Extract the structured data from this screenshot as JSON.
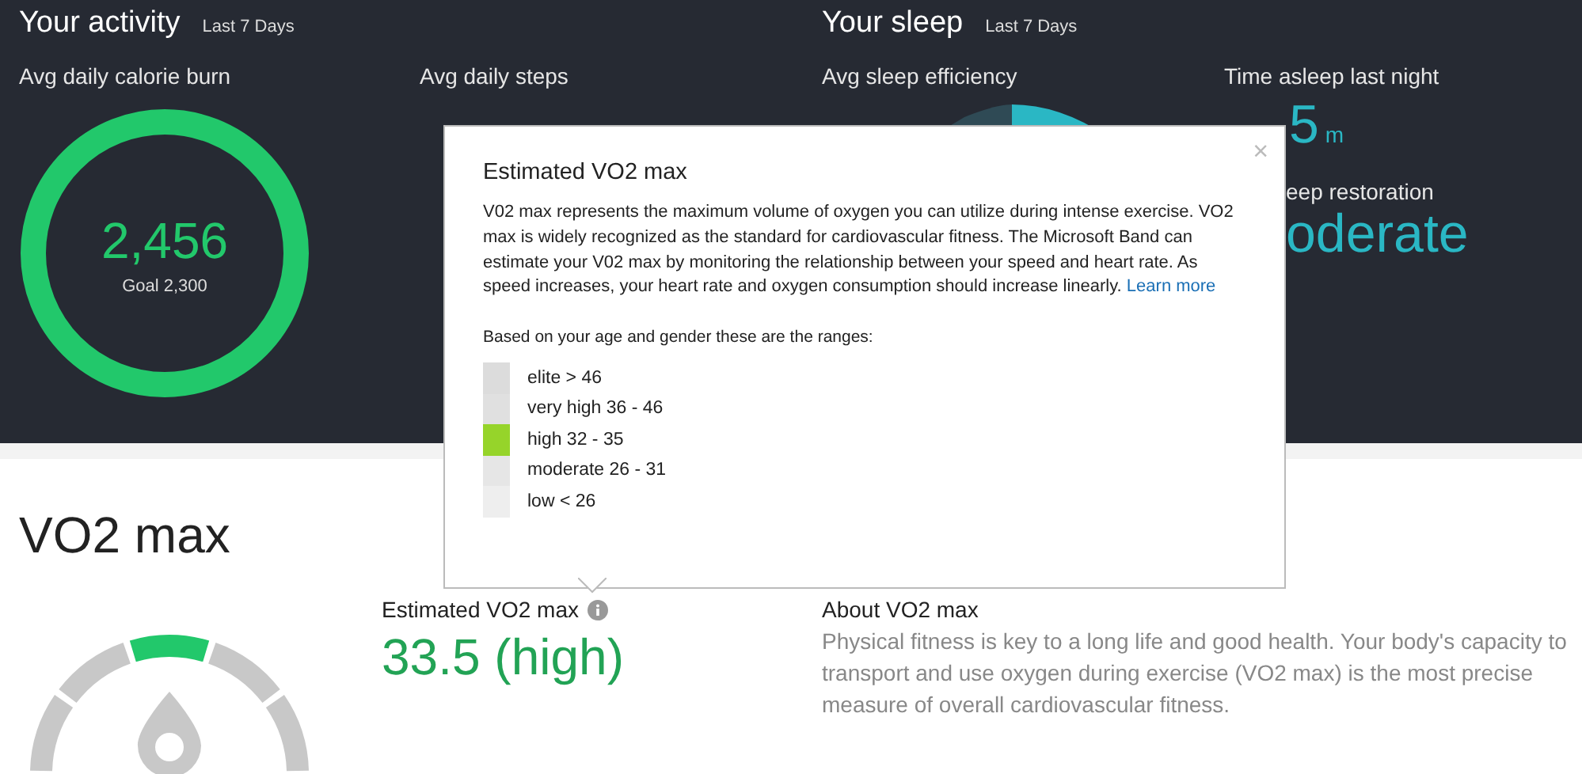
{
  "activity": {
    "title": "Your activity",
    "period": "Last 7 Days",
    "calorie": {
      "label": "Avg daily calorie burn",
      "value": "2,456",
      "goal": "Goal 2,300"
    },
    "steps": {
      "label": "Avg daily steps"
    }
  },
  "sleep": {
    "title": "Your sleep",
    "period": "Last 7 Days",
    "efficiency": {
      "label": "Avg sleep efficiency"
    },
    "time_asleep": {
      "label": "Time asleep last night",
      "minutes": "5",
      "unit": "m"
    },
    "restoration": {
      "label": "eep restoration",
      "value": "oderate"
    }
  },
  "popup": {
    "title": "Estimated VO2 max",
    "close": "×",
    "body": "V02 max represents the maximum volume of oxygen you can utilize during intense exercise. VO2 max is widely recognized as the standard for cardiovascular fitness. The Microsoft Band can estimate your V02 max by monitoring the relationship between your speed and heart rate. As speed increases, your heart rate and oxygen consumption should increase linearly.",
    "link": "Learn more",
    "ranges_intro": "Based on your age and gender these are the ranges:",
    "ranges": [
      {
        "label": "elite > 46",
        "selected": false
      },
      {
        "label": "very high 36 - 46",
        "selected": false
      },
      {
        "label": "high 32 - 35",
        "selected": true
      },
      {
        "label": "moderate 26 - 31",
        "selected": false
      },
      {
        "label": "low < 26",
        "selected": false
      }
    ]
  },
  "vo2": {
    "title": "VO2 max",
    "estimate_label": "Estimated VO2 max",
    "estimate_value": "33.5 (high)",
    "about_title": "About VO2 max",
    "about_text": "Physical fitness is key to a long life and good health. Your body's capacity to transport and use oxygen during exercise (VO2 max) is the most precise measure of overall cardiovascular fitness."
  }
}
